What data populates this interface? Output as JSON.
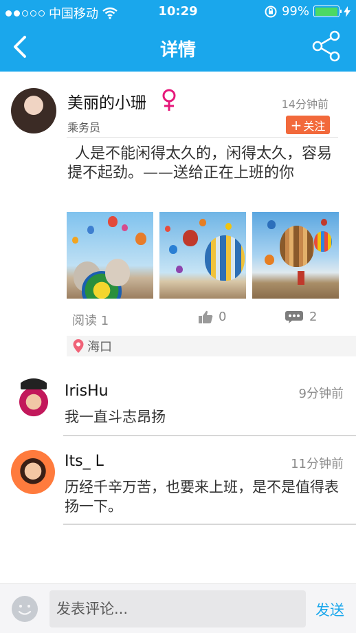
{
  "status_bar": {
    "carrier": "中国移动",
    "time": "10:29",
    "battery": "99%",
    "battery_level": 0.99
  },
  "nav": {
    "title": "详情",
    "back_icon": "chevron-left-icon",
    "share_icon": "share-icon"
  },
  "post": {
    "author_name": "美丽的小珊",
    "gender_icon": "female-icon",
    "time": "14分钟前",
    "role": "乘务员",
    "follow_label": "关注",
    "text": "人是不能闲得太久的，闲得太久，容易提不起劲。——送给正在上班的你",
    "read_label": "阅读 1",
    "like_count": "0",
    "comment_count": "2",
    "location": "海口"
  },
  "comments": [
    {
      "name": "IrisHu",
      "time": "9分钟前",
      "text": "我一直斗志昂扬"
    },
    {
      "name": "Its_ L",
      "time": "11分钟前",
      "text": "历经千辛万苦，也要来上班，是不是值得表扬一下。"
    }
  ],
  "bottom": {
    "placeholder": "发表评论...",
    "send_label": "发送"
  },
  "colors": {
    "accent": "#1aa7ec",
    "follow": "#f2693b",
    "female": "#e6177a"
  }
}
